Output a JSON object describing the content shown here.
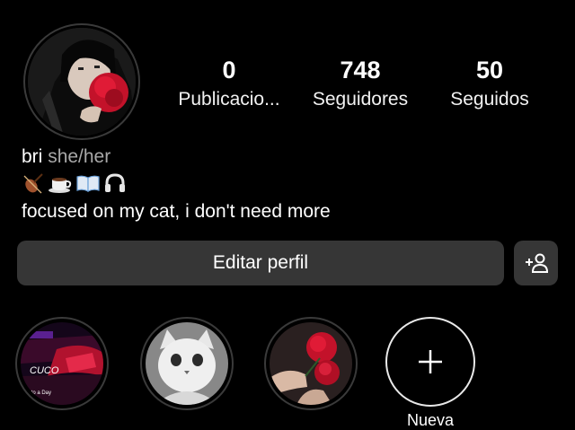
{
  "profile": {
    "name": "bri",
    "pronouns": "she/her",
    "bio": "focused on my cat, i don't need more",
    "emoji_icons": [
      "violin-icon",
      "coffee-cup-icon",
      "open-book-icon",
      "headphones-icon"
    ]
  },
  "stats": {
    "posts": {
      "value": "0",
      "label": "Publicacio..."
    },
    "followers": {
      "value": "748",
      "label": "Seguidores"
    },
    "following": {
      "value": "50",
      "label": "Seguidos"
    }
  },
  "actions": {
    "edit_profile": "Editar perfil",
    "add_person_icon": "add-person-icon"
  },
  "highlights": {
    "items": [
      {
        "thumb_text": "CUCO",
        "thumb_caption": "r to a Day"
      },
      {
        "thumb_text": "",
        "thumb_caption": ""
      },
      {
        "thumb_text": "",
        "thumb_caption": ""
      }
    ],
    "new_label": "Nueva"
  },
  "colors": {
    "background": "#000000",
    "button": "#363636",
    "muted_text": "#a8a8a8",
    "rose_red": "#d8102a"
  }
}
